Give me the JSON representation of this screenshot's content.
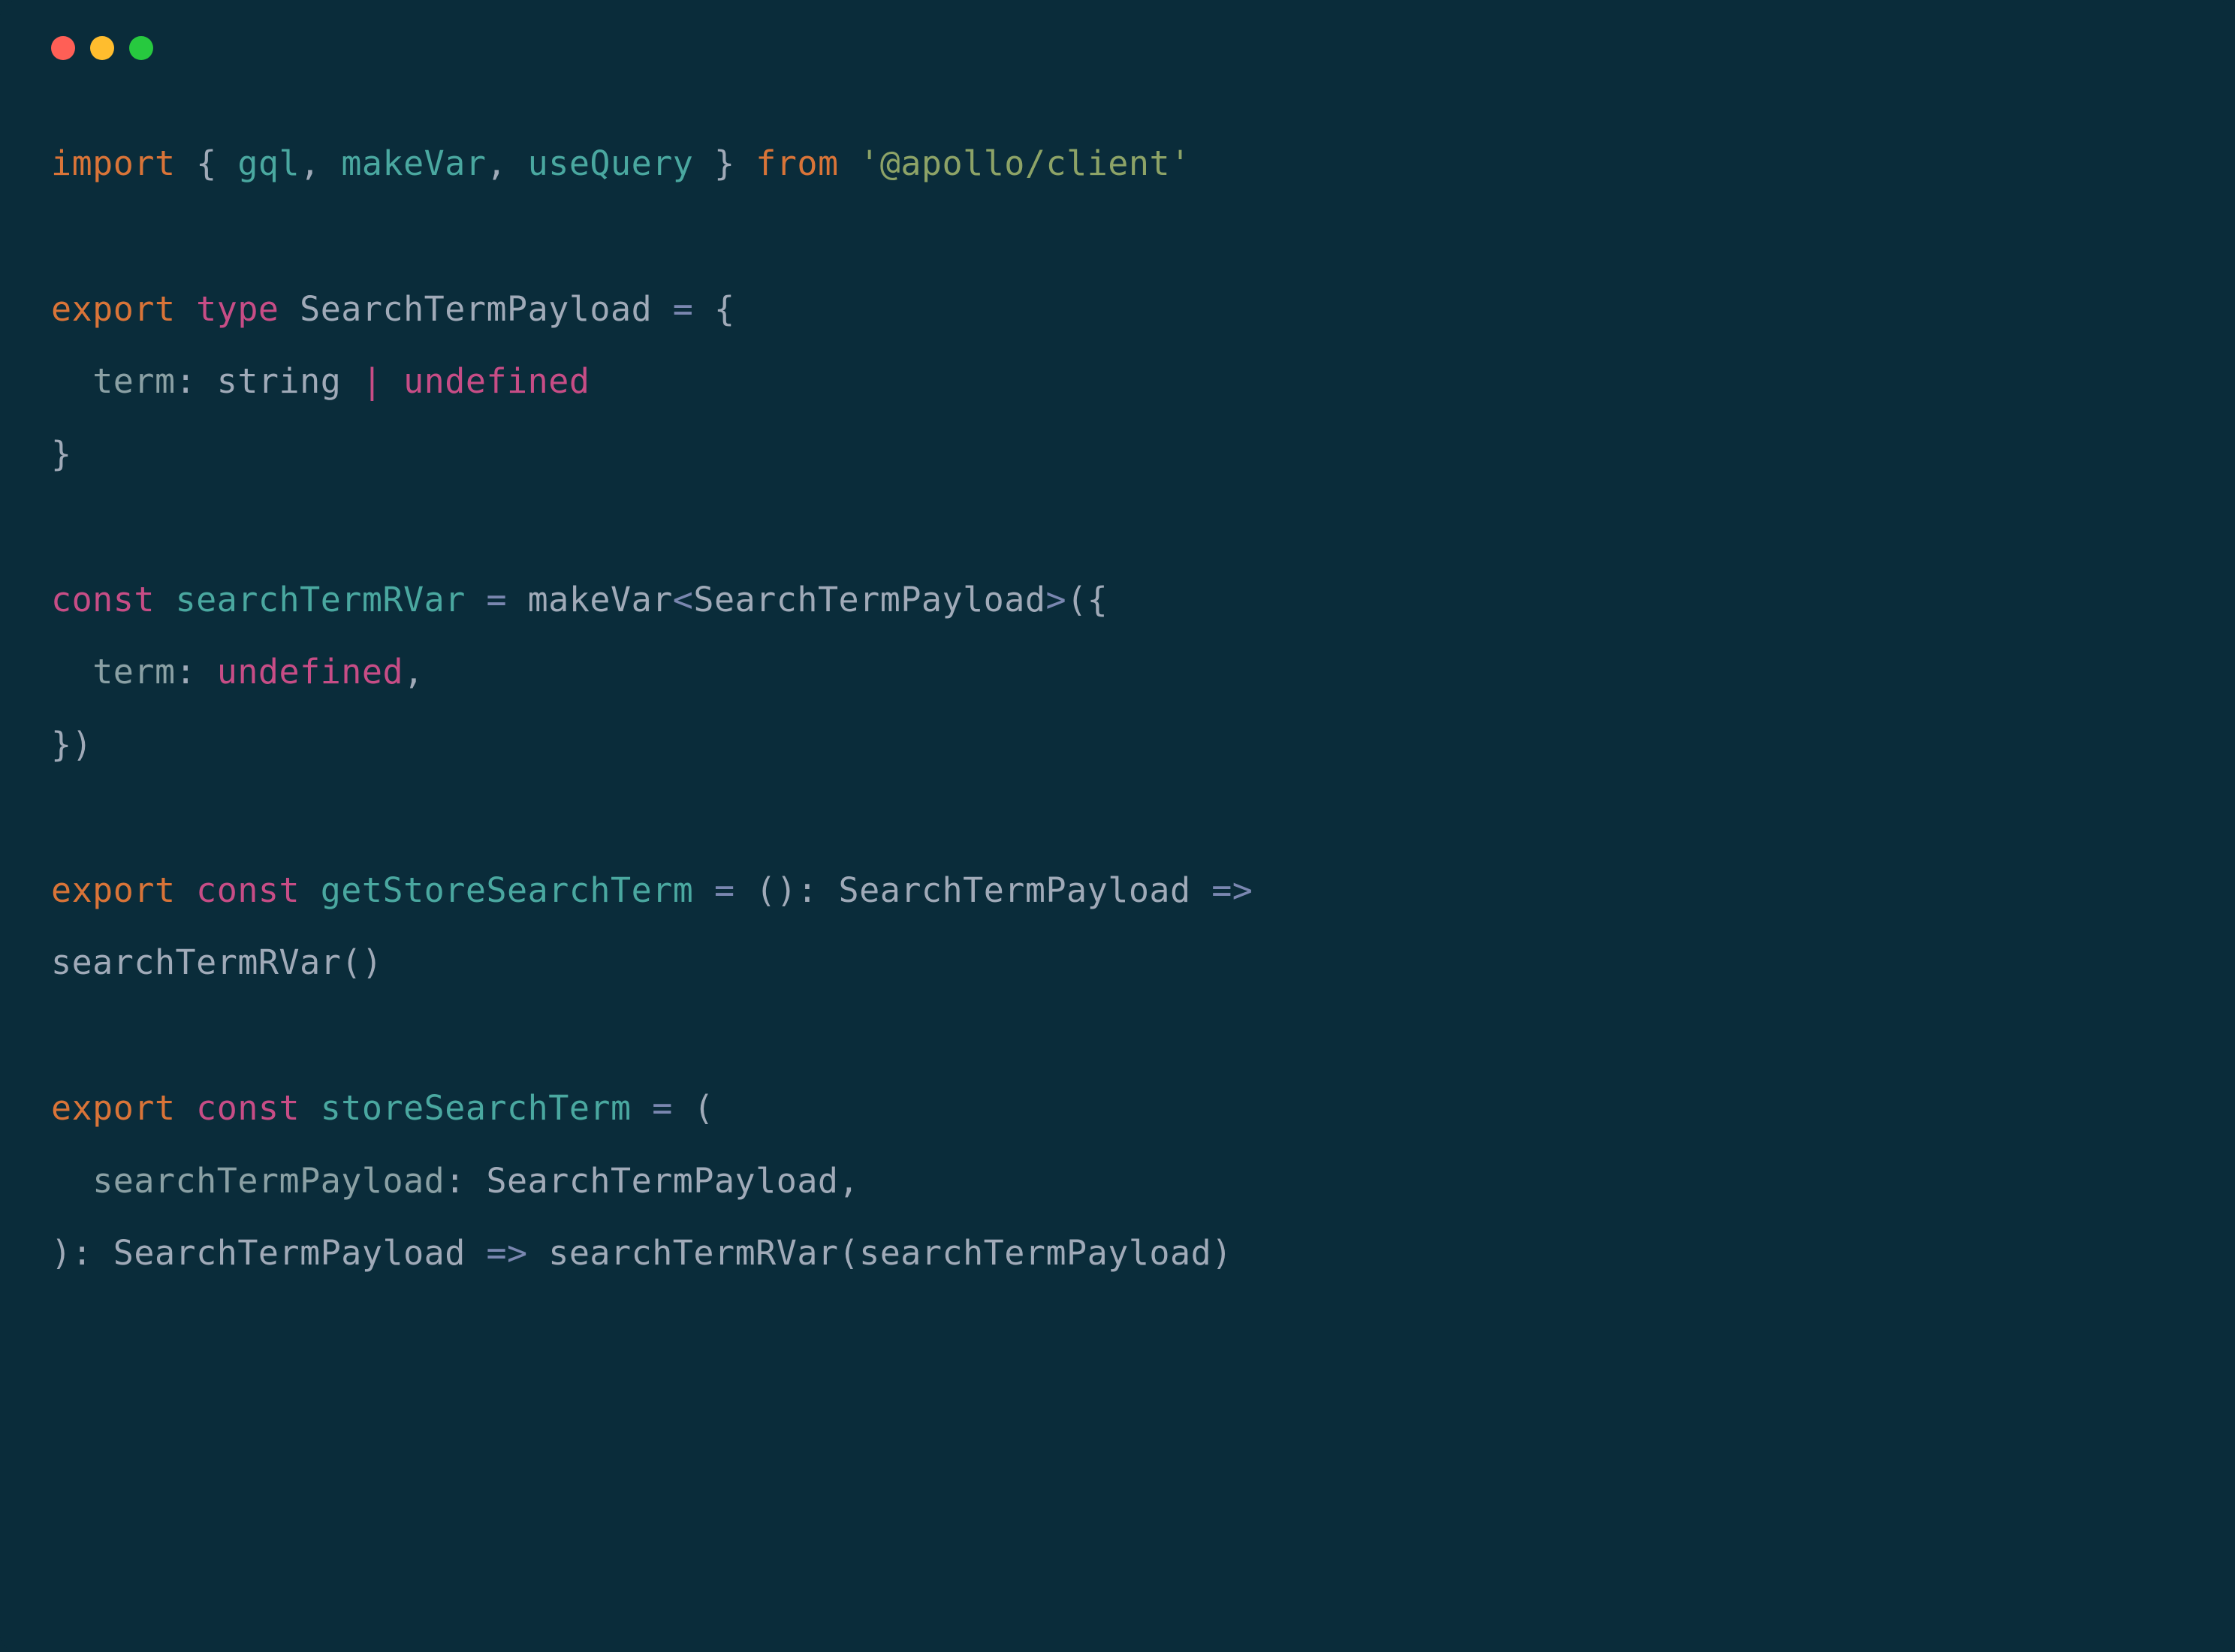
{
  "titlebar": {
    "dots": [
      "red",
      "yellow",
      "green"
    ]
  },
  "code": {
    "line1": {
      "import": "import",
      "brace_open": " { ",
      "gql": "gql",
      "comma1": ", ",
      "makeVar": "makeVar",
      "comma2": ", ",
      "useQuery": "useQuery",
      "brace_close": " } ",
      "from": "from",
      "space": " ",
      "module": "'@apollo/client'"
    },
    "line3": {
      "export": "export",
      "space1": " ",
      "type": "type",
      "space2": " ",
      "name": "SearchTermPayload",
      "space3": " ",
      "eq": "=",
      "space4": " ",
      "brace": "{"
    },
    "line4": {
      "indent": "  ",
      "prop": "term",
      "colon": ": ",
      "string": "string",
      "space": " ",
      "pipe": "|",
      "space2": " ",
      "undefined": "undefined"
    },
    "line5": {
      "brace": "}"
    },
    "line7": {
      "const": "const",
      "space1": " ",
      "name": "searchTermRVar",
      "space2": " ",
      "eq": "=",
      "space3": " ",
      "call": "makeVar",
      "lt": "<",
      "generic": "SearchTermPayload",
      "gt": ">",
      "paren": "({"
    },
    "line8": {
      "indent": "  ",
      "prop": "term",
      "colon": ": ",
      "undefined": "undefined",
      "comma": ","
    },
    "line9": {
      "close": "})"
    },
    "line11": {
      "export": "export",
      "space1": " ",
      "const": "const",
      "space2": " ",
      "name": "getStoreSearchTerm",
      "space3": " ",
      "eq": "=",
      "space4": " ",
      "parens": "()",
      "colon": ": ",
      "rettype": "SearchTermPayload",
      "space5": " ",
      "arrow": "=>"
    },
    "line12": {
      "call": "searchTermRVar()"
    },
    "line14": {
      "export": "export",
      "space1": " ",
      "const": "const",
      "space2": " ",
      "name": "storeSearchTerm",
      "space3": " ",
      "eq": "=",
      "space4": " ",
      "paren": "("
    },
    "line15": {
      "indent": "  ",
      "param": "searchTermPayload",
      "colon": ": ",
      "ptype": "SearchTermPayload",
      "comma": ","
    },
    "line16": {
      "paren": ")",
      "colon": ": ",
      "rettype": "SearchTermPayload",
      "space": " ",
      "arrow": "=>",
      "space2": " ",
      "call": "searchTermRVar(searchTermPayload)"
    }
  }
}
